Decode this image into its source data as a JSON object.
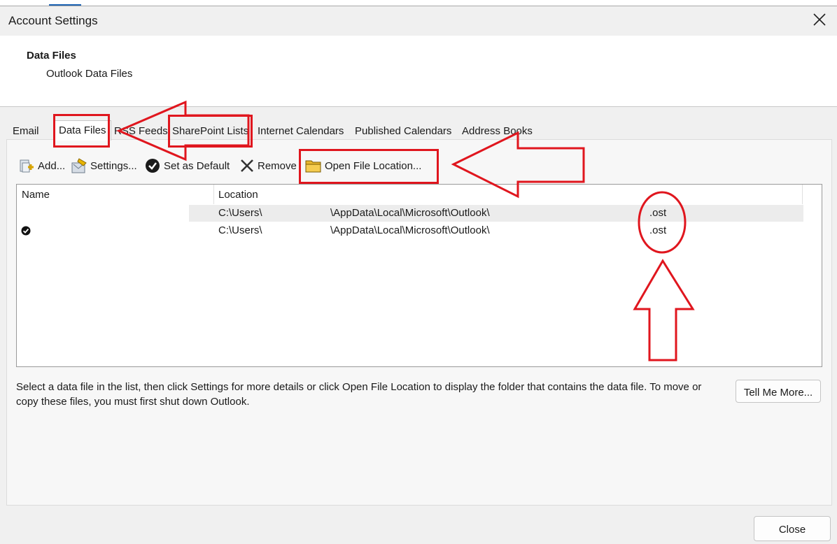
{
  "window": {
    "title": "Account Settings"
  },
  "header": {
    "heading": "Data Files",
    "subheading": "Outlook Data Files"
  },
  "tabs": [
    {
      "label": "Email"
    },
    {
      "label": "Data Files"
    },
    {
      "label": "RSS Feeds"
    },
    {
      "label": "SharePoint Lists"
    },
    {
      "label": "Internet Calendars"
    },
    {
      "label": "Published Calendars"
    },
    {
      "label": "Address Books"
    }
  ],
  "toolbar": {
    "add": "Add...",
    "settings": "Settings...",
    "set_default": "Set as Default",
    "remove": "Remove",
    "open_location": "Open File Location..."
  },
  "list": {
    "columns": {
      "name": "Name",
      "location": "Location"
    },
    "rows": [
      {
        "loc_a": "C:\\Users\\",
        "loc_b": "\\AppData\\Local\\Microsoft\\Outlook\\",
        "ext": ".ost",
        "default": false,
        "selected": true
      },
      {
        "loc_a": "C:\\Users\\",
        "loc_b": "\\AppData\\Local\\Microsoft\\Outlook\\",
        "ext": ".ost",
        "default": true,
        "selected": false
      }
    ]
  },
  "description": "Select a data file in the list, then click Settings for more details or click Open File Location to display the folder that contains the data file. To move or copy these files, you must first shut down Outlook.",
  "buttons": {
    "tell_me_more": "Tell Me More...",
    "close": "Close"
  },
  "annotation_color": "#e0161e"
}
